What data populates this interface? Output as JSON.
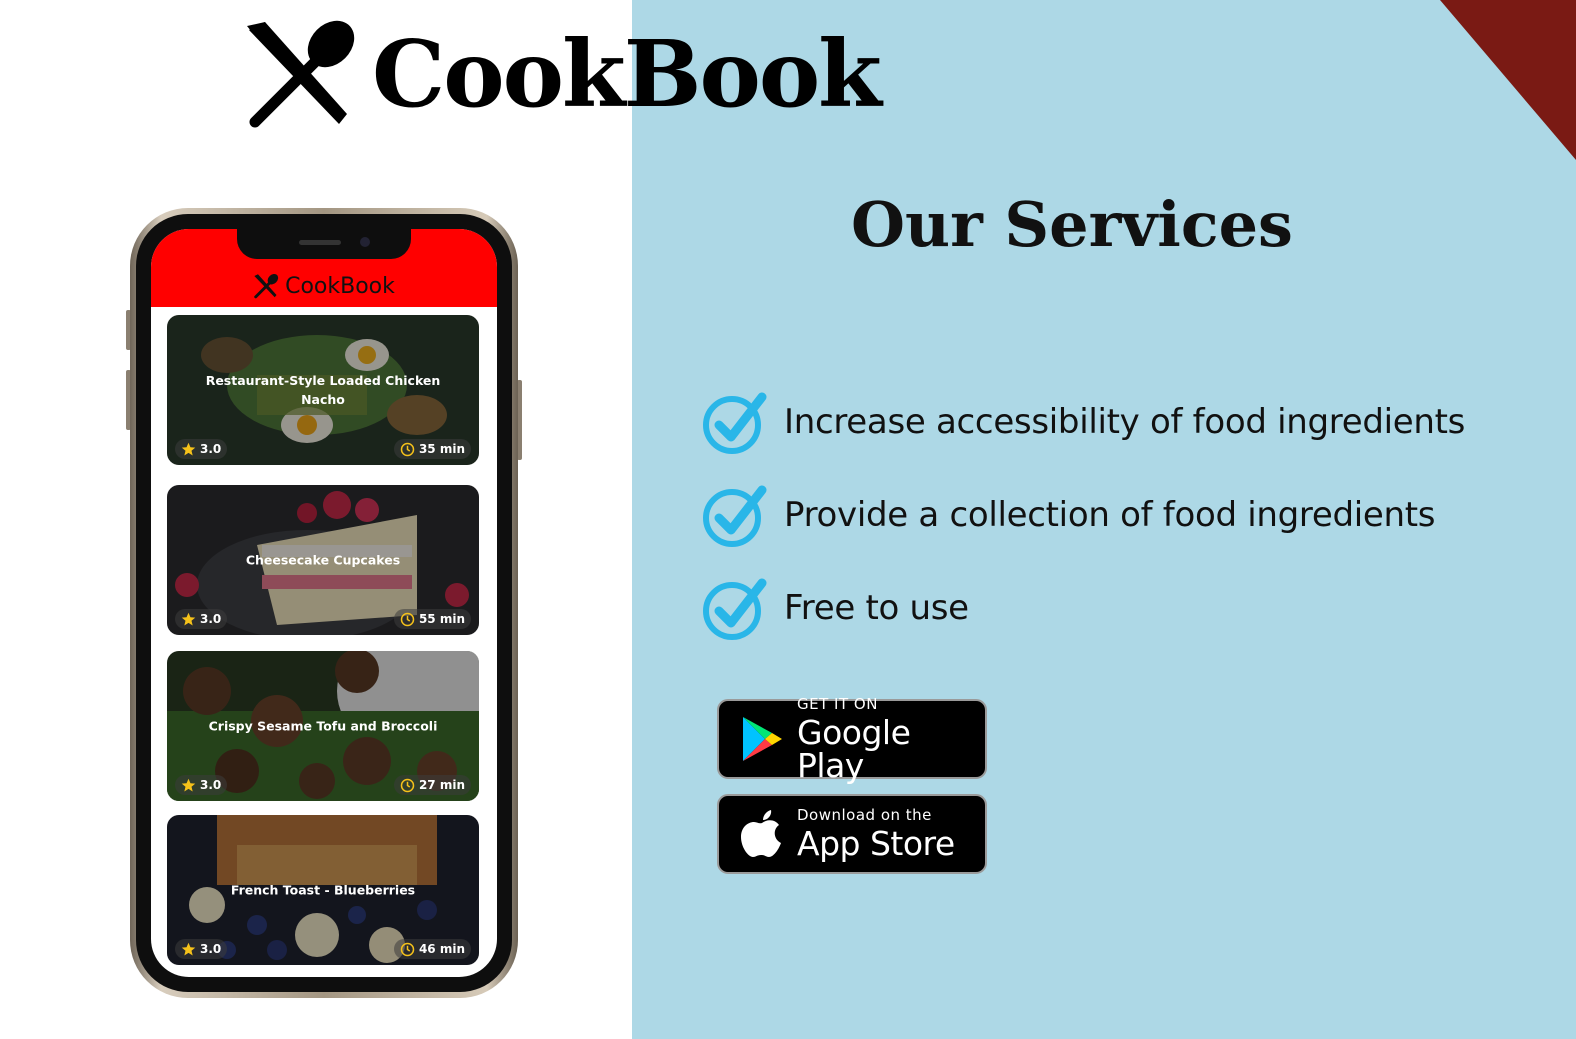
{
  "brand": {
    "title": "CookBook",
    "icon": "fork-spoon-crossed-icon"
  },
  "services": {
    "title": "Our Services",
    "items": [
      "Increase accessibility of food ingredients",
      "Provide a collection of food ingredients",
      "Free to use"
    ],
    "check_icon": "checkmark-circle-icon",
    "check_color": "#29b6e8"
  },
  "store_badges": {
    "google": {
      "small": "GET IT ON",
      "big": "Google Play",
      "icon": "google-play-icon"
    },
    "apple": {
      "small": "Download on the",
      "big": "App Store",
      "icon": "apple-icon"
    }
  },
  "phone_app": {
    "header_title": "CookBook",
    "header_color": "#ff0000",
    "recipes": [
      {
        "title": "Restaurant-Style Loaded Chicken Nacho",
        "rating": "3.0",
        "time": "35 min"
      },
      {
        "title": "Cheesecake Cupcakes",
        "rating": "3.0",
        "time": "55 min"
      },
      {
        "title": "Crispy Sesame Tofu and Broccoli",
        "rating": "3.0",
        "time": "27 min"
      },
      {
        "title": "French Toast - Blueberries",
        "rating": "3.0",
        "time": "46 min"
      }
    ]
  },
  "colors": {
    "panel_blue": "#add8e6",
    "corner_accent": "#7a1a14",
    "star": "#f6c21a"
  }
}
